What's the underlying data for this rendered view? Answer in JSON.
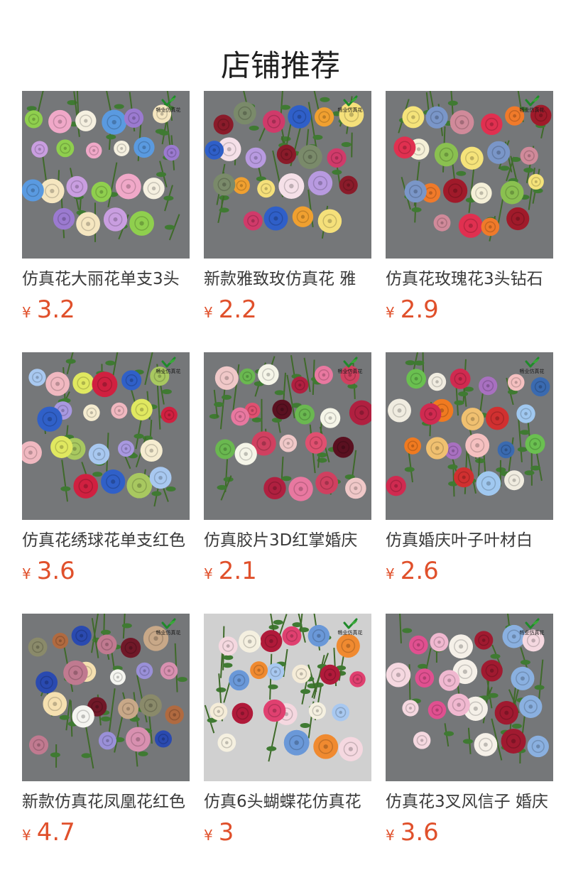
{
  "section": {
    "title": "店铺推荐"
  },
  "brand": {
    "name": "畅业仿真花",
    "icon": "green-leaf-check-icon"
  },
  "currency_symbol": "¥",
  "colors": {
    "price": "#e0502b",
    "title_text": "#3a3a3a",
    "heading": "#1f1f1f"
  },
  "products": [
    {
      "title": "仿真花大丽花单支3头",
      "price": "3.2",
      "image": "dahlia-flowers",
      "flowers": [
        "#8fcf4e",
        "#f0a8c8",
        "#f5f0e0",
        "#5a9ae0",
        "#9b7ad0",
        "#f5e6c0",
        "#c99ee0"
      ]
    },
    {
      "title": "新款雅致玫仿真花 雅",
      "price": "2.2",
      "image": "rose-variety",
      "flowers": [
        "#8a1b2a",
        "#7a8a6a",
        "#d03a6a",
        "#2f5fc8",
        "#f0a030",
        "#f5e07a",
        "#f5e0e8",
        "#b89ae0"
      ]
    },
    {
      "title": "仿真花玫瑰花3头钻石",
      "price": "2.9",
      "image": "rose-three-head",
      "flowers": [
        "#f5e37a",
        "#7a96c8",
        "#d08a9a",
        "#e03050",
        "#f07a2a",
        "#a01a2a",
        "#f5f0d8",
        "#8ac050"
      ]
    },
    {
      "title": "仿真花绣球花单支红色",
      "price": "3.6",
      "image": "hydrangea",
      "flowers": [
        "#f0b8c0",
        "#e0e860",
        "#d02040",
        "#3060c8",
        "#a8c860",
        "#a8c8f0",
        "#a898e0",
        "#f5ecd0"
      ]
    },
    {
      "title": "仿真胶片3D红掌婚庆",
      "price": "2.1",
      "image": "anthurium",
      "flowers": [
        "#6ab850",
        "#f5f5e8",
        "#b02040",
        "#e878a0",
        "#d04060",
        "#f0c8c8",
        "#e05070",
        "#5a1020"
      ]
    },
    {
      "title": "仿真婚庆叶子叶材白",
      "price": "2.6",
      "image": "foliage",
      "flowers": [
        "#f0ece0",
        "#d02a50",
        "#a870c0",
        "#f5c0c0",
        "#3a6ab0",
        "#6ac050",
        "#f07a20",
        "#f0c070",
        "#d03030",
        "#a0c8f0"
      ]
    },
    {
      "title": "新款仿真花凤凰花红色",
      "price": "4.7",
      "image": "phoenix-flower",
      "flowers": [
        "#2a4ab0",
        "#c07a90",
        "#701828",
        "#c8a888",
        "#8a8a6a",
        "#b06a40",
        "#f5e0b0",
        "#f5f5f0",
        "#9a90d8",
        "#d890b0"
      ]
    },
    {
      "title": "仿真6头蝴蝶花仿真花",
      "price": "3",
      "image": "butterfly-flower",
      "flowers": [
        "#b01a3a",
        "#e04070",
        "#6a98d8",
        "#f08a30",
        "#f5d8e0",
        "#f5f0e0",
        "#a8c8f0",
        "#f5ecd8"
      ]
    },
    {
      "title": "仿真花3叉风信子 婚庆",
      "price": "3.6",
      "image": "hyacinth",
      "flowers": [
        "#f5f0e8",
        "#a01a30",
        "#8ab0e0",
        "#f5d8e0",
        "#e05090",
        "#f0b8d0"
      ]
    }
  ]
}
